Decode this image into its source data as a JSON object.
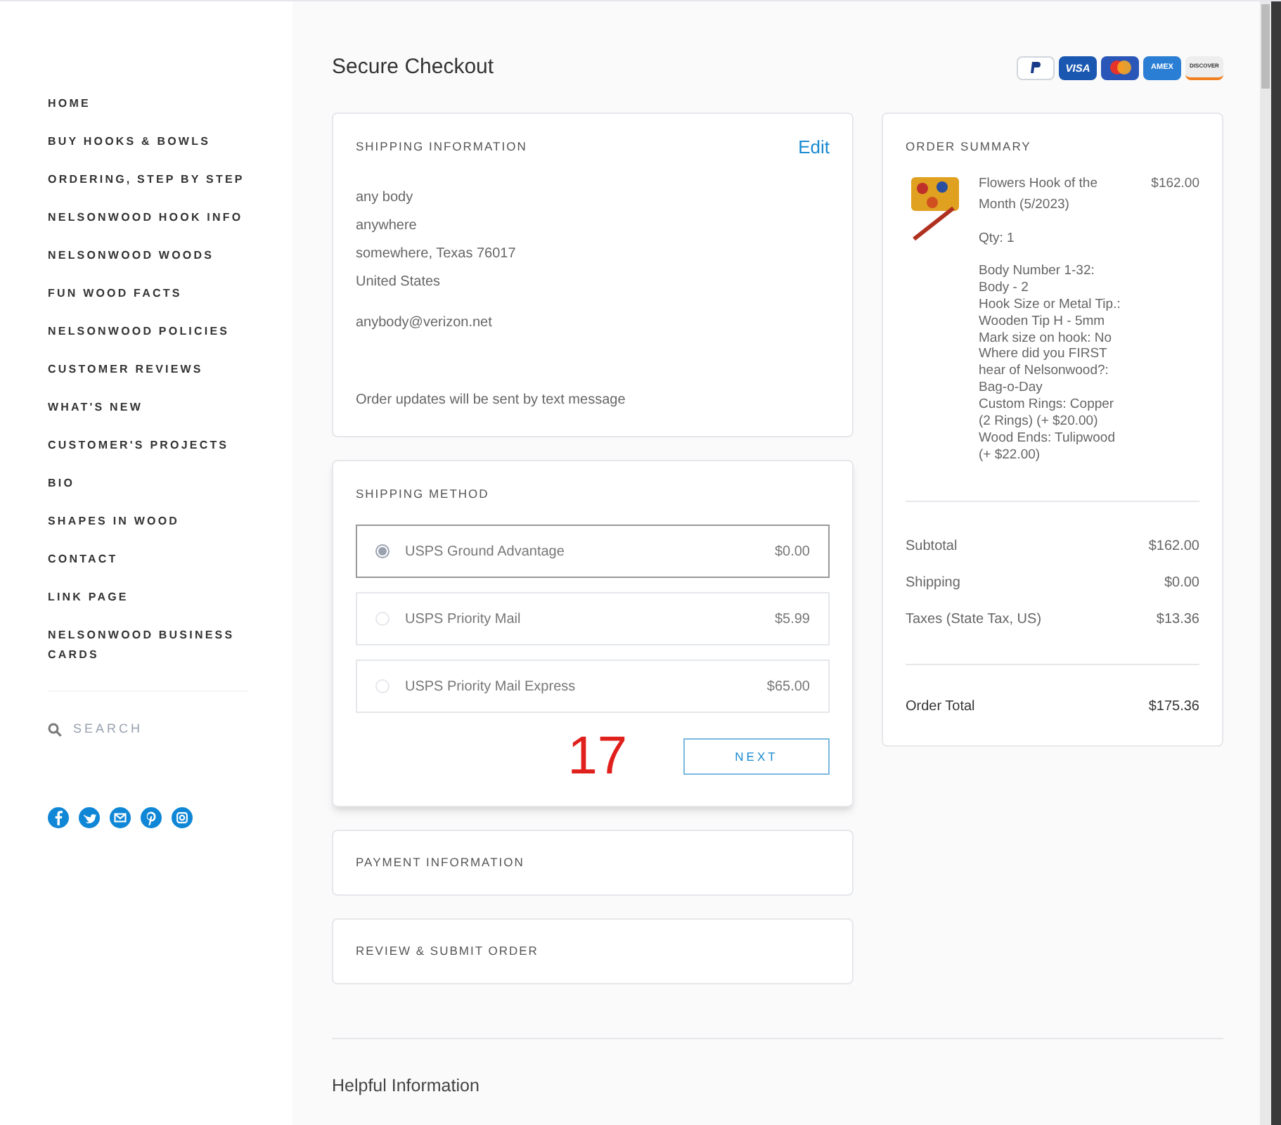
{
  "sidebar": {
    "nav_items": [
      "HOME",
      "BUY HOOKS & BOWLS",
      "ORDERING, STEP BY STEP",
      "NELSONWOOD HOOK INFO",
      "NELSONWOOD WOODS",
      "FUN WOOD FACTS",
      "NELSONWOOD POLICIES",
      "CUSTOMER REVIEWS",
      "WHAT'S NEW",
      "CUSTOMER'S PROJECTS",
      "BIO",
      "SHAPES IN WOOD",
      "CONTACT",
      "LINK PAGE",
      "NELSONWOOD BUSINESS CARDS"
    ],
    "search": {
      "placeholder": "SEARCH"
    },
    "social": [
      {
        "kind": "facebook"
      },
      {
        "kind": "twitter"
      },
      {
        "kind": "email"
      },
      {
        "kind": "pinterest"
      },
      {
        "kind": "instagram"
      }
    ]
  },
  "page_title": "Secure Checkout",
  "payment_methods": [
    {
      "kind": "paypal"
    },
    {
      "kind": "visa",
      "label": "VISA"
    },
    {
      "kind": "mastercard"
    },
    {
      "kind": "amex",
      "label": "AMEX"
    },
    {
      "kind": "discover",
      "label": "DISCOVER"
    }
  ],
  "shipping_information": {
    "heading": "SHIPPING INFORMATION",
    "edit": "Edit",
    "address": [
      "any body",
      "anywhere",
      "somewhere, Texas 76017",
      "United States"
    ],
    "email": "anybody@verizon.net",
    "note": "Order updates will be sent by text message"
  },
  "shipping_method": {
    "heading": "SHIPPING METHOD",
    "options": [
      {
        "label": "USPS Ground Advantage",
        "price": "$0.00",
        "selected": true
      },
      {
        "label": "USPS Priority Mail",
        "price": "$5.99",
        "selected": false
      },
      {
        "label": "USPS Priority Mail Express",
        "price": "$65.00",
        "selected": false
      }
    ],
    "annotation": "17",
    "next": "NEXT"
  },
  "collapsed_steps": [
    "PAYMENT INFORMATION",
    "REVIEW & SUBMIT ORDER"
  ],
  "order_summary": {
    "heading": "ORDER SUMMARY",
    "item": {
      "name": "Flowers Hook of the Month (5/2023)",
      "price": "$162.00",
      "qty": "Qty: 1",
      "options": [
        "Body Number 1-32: Body - 2",
        "Hook Size or Metal Tip.: Wooden Tip H - 5mm",
        "Mark size on hook: No",
        "Where did you FIRST hear of Nelsonwood?: Bag-o-Day",
        "Custom Rings: Copper (2 Rings) (+ $20.00)",
        "Wood Ends: Tulipwood (+ $22.00)"
      ]
    },
    "lines": [
      {
        "label": "Subtotal",
        "value": "$162.00"
      },
      {
        "label": "Shipping",
        "value": "$0.00"
      },
      {
        "label": "Taxes (State Tax, US)",
        "value": "$13.36"
      }
    ],
    "total": {
      "label": "Order Total",
      "value": "$175.36"
    }
  },
  "helpful_information": "Helpful Information"
}
